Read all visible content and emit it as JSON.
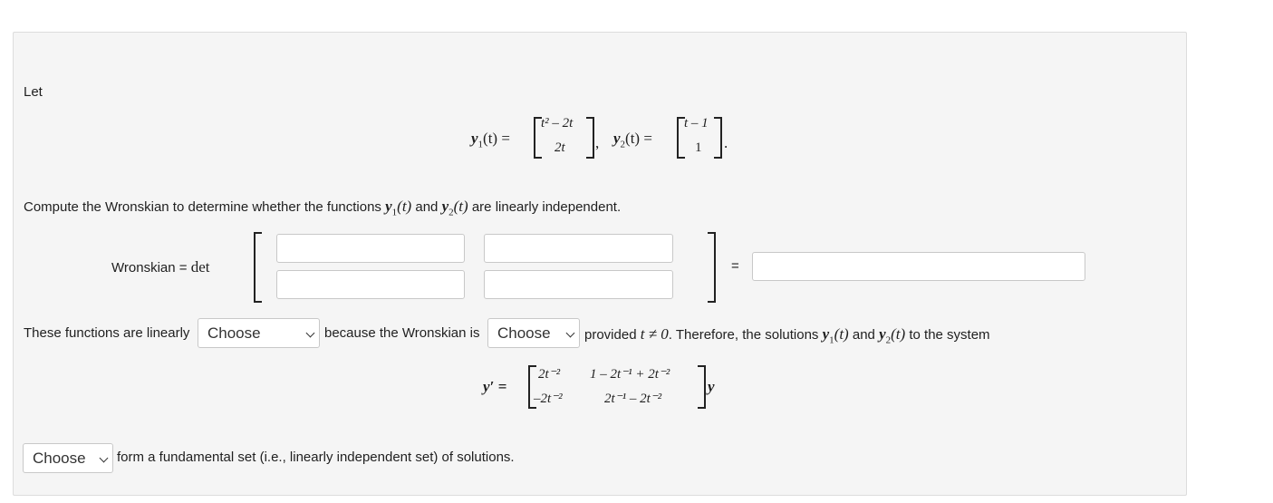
{
  "intro": "Let",
  "y1_label": "y",
  "y1_sub": "1",
  "y1_arg": "(t) =",
  "y1_top": "t² – 2t",
  "y1_bottom": "2t",
  "y2_label": "y",
  "y2_sub": "2",
  "y2_arg": "(t) =",
  "y2_top": "t – 1",
  "y2_bottom": "1",
  "instruction_pre": "Compute the Wronskian to determine whether the functions",
  "instruction_y1": "y",
  "instruction_y1_sub": "1",
  "instruction_y1_arg": "(t)",
  "instruction_and": "and",
  "instruction_y2": "y",
  "instruction_y2_sub": "2",
  "instruction_y2_arg": "(t)",
  "instruction_post": "are linearly independent.",
  "wronskian_label": "Wronskian =",
  "wronskian_det": "det",
  "equals": "=",
  "matrix_inputs": [
    "",
    "",
    "",
    ""
  ],
  "result_input": "",
  "sentence1_pre": "These functions are linearly",
  "select1_value": "Choose",
  "sentence1_mid": "because the Wronskian is",
  "select2_value": "Choose",
  "sentence1_provided": "provided",
  "sentence1_cond": "t ≠ 0",
  "sentence1_post": ". Therefore, the solutions",
  "sentence1_and": "and",
  "sentence1_end": "to the system",
  "sys_lhs": "y′ =",
  "sys_a11": "2t⁻²",
  "sys_a12": "1 – 2t⁻¹ + 2t⁻²",
  "sys_a21": "–2t⁻²",
  "sys_a22": "2t⁻¹ – 2t⁻²",
  "sys_rhs": "y",
  "select3_value": "Choose",
  "final_text": "form a fundamental set (i.e., linearly independent set) of solutions."
}
